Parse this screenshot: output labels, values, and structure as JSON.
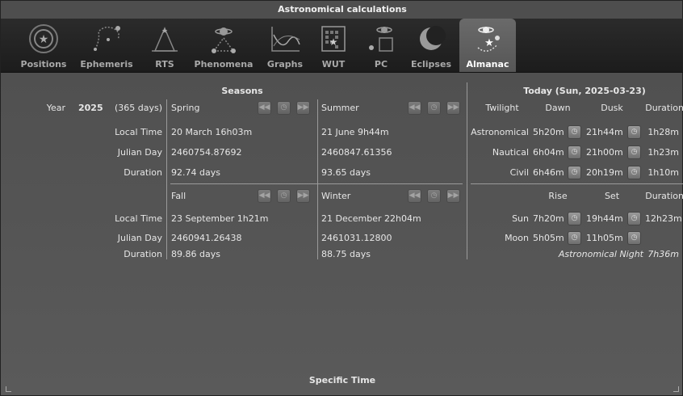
{
  "window": {
    "title": "Astronomical calculations"
  },
  "tabs": [
    {
      "label": "Positions",
      "icon": "positions-icon"
    },
    {
      "label": "Ephemeris",
      "icon": "ephemeris-icon"
    },
    {
      "label": "RTS",
      "icon": "rts-icon"
    },
    {
      "label": "Phenomena",
      "icon": "phenomena-icon"
    },
    {
      "label": "Graphs",
      "icon": "graphs-icon"
    },
    {
      "label": "WUT",
      "icon": "wut-icon"
    },
    {
      "label": "PC",
      "icon": "pc-icon"
    },
    {
      "label": "Eclipses",
      "icon": "eclipses-icon"
    },
    {
      "label": "Almanac",
      "icon": "almanac-icon",
      "active": true
    }
  ],
  "seasons": {
    "header": "Seasons",
    "year_label": "Year",
    "year": "2025",
    "days": "(365 days)",
    "row_labels": {
      "local_time": "Local Time",
      "julian_day": "Julian Day",
      "duration": "Duration"
    },
    "spring": {
      "name": "Spring",
      "local_time": "20 March 16h03m",
      "julian_day": "2460754.87692",
      "duration": "92.74 days"
    },
    "summer": {
      "name": "Summer",
      "local_time": "21 June 9h44m",
      "julian_day": "2460847.61356",
      "duration": "93.65 days"
    },
    "fall": {
      "name": "Fall",
      "local_time": "23 September 1h21m",
      "julian_day": "2460941.26438",
      "duration": "89.86 days"
    },
    "winter": {
      "name": "Winter",
      "local_time": "21 December 22h04m",
      "julian_day": "2461031.12800",
      "duration": "88.75 days"
    }
  },
  "today": {
    "header": "Today (Sun, 2025-03-23)",
    "twilight_cols": {
      "twilight": "Twilight",
      "dawn": "Dawn",
      "dusk": "Dusk",
      "duration": "Duration"
    },
    "twilight_rows": [
      {
        "name": "Astronomical",
        "dawn": "5h20m",
        "dusk": "21h44m",
        "duration": "1h28m"
      },
      {
        "name": "Nautical",
        "dawn": "6h04m",
        "dusk": "21h00m",
        "duration": "1h23m"
      },
      {
        "name": "Civil",
        "dawn": "6h46m",
        "dusk": "20h19m",
        "duration": "1h10m"
      }
    ],
    "rise_cols": {
      "rise": "Rise",
      "set": "Set",
      "duration": "Duration"
    },
    "rise_rows": [
      {
        "name": "Sun",
        "rise": "7h20m",
        "set": "19h44m",
        "duration": "12h23m"
      },
      {
        "name": "Moon",
        "rise": "5h05m",
        "set": "11h05m",
        "duration": ""
      }
    ],
    "night_label": "Astronomical Night",
    "night_value": "7h36m"
  },
  "footer": {
    "specific_time": "Specific Time"
  }
}
